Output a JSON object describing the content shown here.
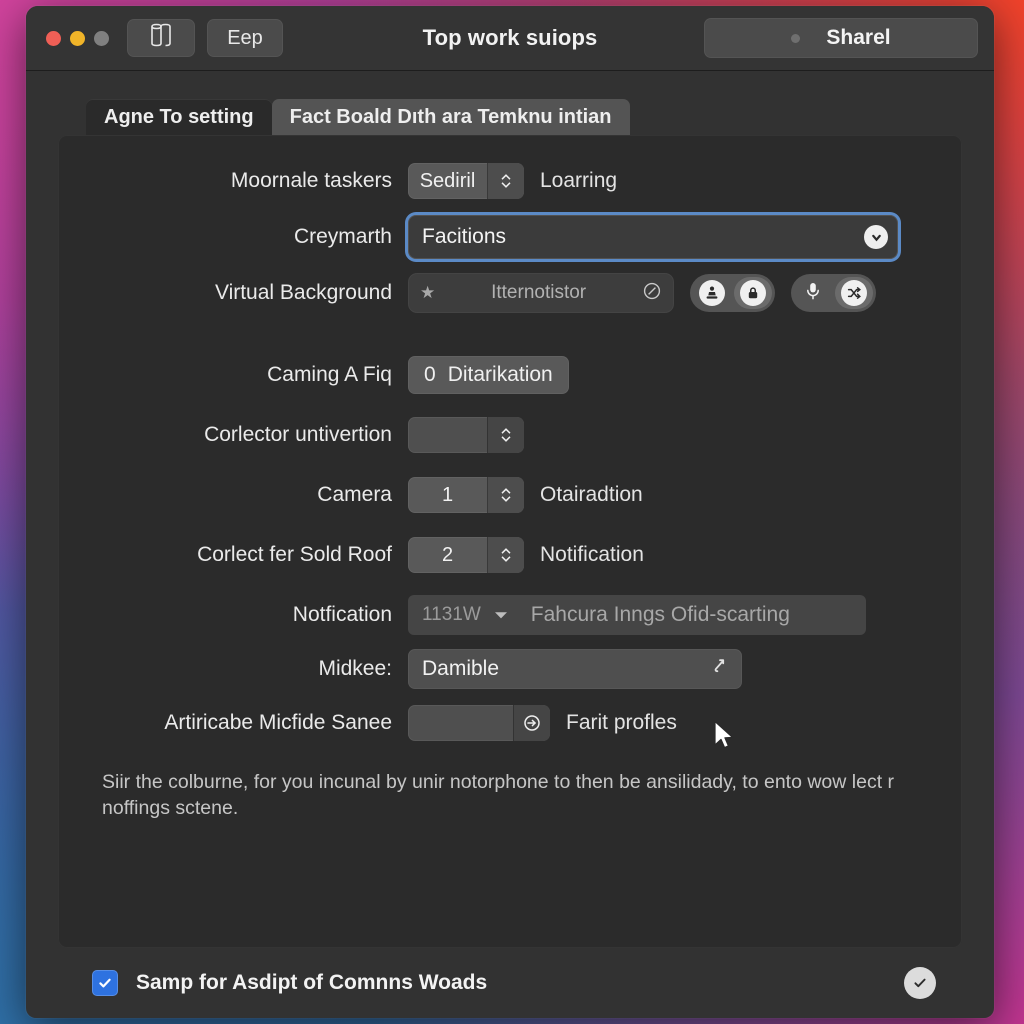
{
  "window": {
    "titlebar": {
      "title": "Top work suiops",
      "icon_button": "book-icon",
      "text_button_label": "Eep",
      "share_button_label": "Sharel"
    }
  },
  "tabs": [
    {
      "label": "Agne To setting",
      "active": true
    },
    {
      "label": "Fact Boald Dıth ara Temknu intian",
      "active": false
    }
  ],
  "form": {
    "rows": [
      {
        "label": "Moornale taskers",
        "control": "stepper",
        "value": "Sediril",
        "trailing": "Loarring"
      },
      {
        "label": "Creymarth",
        "control": "combobox-focused",
        "value": "Facitions",
        "trailing": ""
      },
      {
        "label": "Virtual Background",
        "control": "pill-and-segments",
        "pill_text": "Itternotistor",
        "pill_star_icon": "star-icon",
        "pill_trailing_icon": "slashed-circle-icon",
        "segments": [
          {
            "icon": "stamp-icon",
            "filled": false
          },
          {
            "icon": "lock-icon",
            "filled": true
          },
          {
            "icon": "microphone-icon",
            "filled": false
          },
          {
            "icon": "shuffle-icon",
            "filled": true
          }
        ]
      },
      {
        "label": "Caming A Fiq",
        "control": "flat-button",
        "badge": "0",
        "value": "Ditarikation",
        "trailing": ""
      },
      {
        "label": "Corlector untivertion",
        "control": "stepper",
        "value": "",
        "trailing": ""
      },
      {
        "label": "Camera",
        "control": "stepper",
        "value": "1",
        "trailing": "Otairadtion"
      },
      {
        "label": "Corlect fer Sold Roof",
        "control": "stepper",
        "value": "2",
        "trailing": "Notification"
      },
      {
        "label": "Notfication",
        "control": "strip",
        "strip_number": "1131W",
        "strip_text": "Fahcura Inngs Ofid-scarting",
        "trailing": ""
      },
      {
        "label": "Midkee:",
        "control": "combo-plain",
        "value": "Damible",
        "trailing": ""
      },
      {
        "label": "Artiricabe Micfide Sanee",
        "control": "stepper-arrow",
        "value": "",
        "trailing": "Farit profles"
      }
    ],
    "help_text": "Siir the colburne, for you incunal by unir notorphone to then be ansilidady, to ento wow lect r noffings sctene."
  },
  "bottom": {
    "checkbox_checked": true,
    "label": "Samp for Asdipt of Comnns Woads",
    "confirm_icon": "check-circle-icon"
  },
  "colors": {
    "accent_blue": "#2e72e0",
    "focus_ring": "#5b8ac6",
    "window_bg": "#323232",
    "panel_bg": "#2b2b2b",
    "titlebar_bg": "#343434",
    "traffic_red": "#ef5f56",
    "traffic_yellow": "#f0b429",
    "traffic_gray": "#808080"
  }
}
